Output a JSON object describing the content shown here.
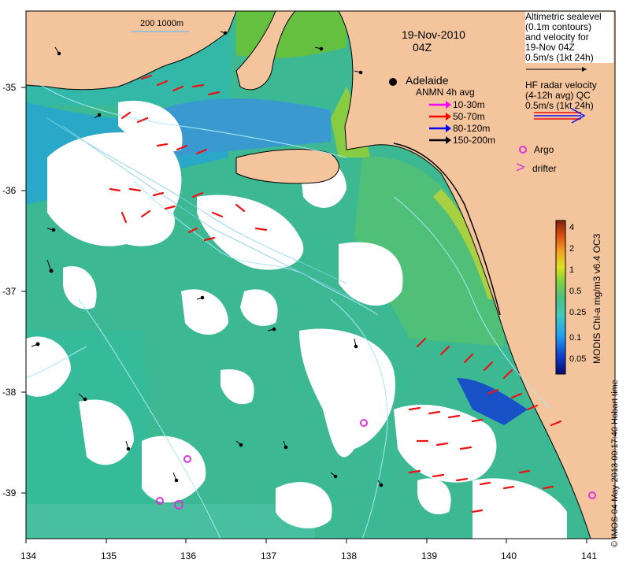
{
  "map": {
    "date": "19-Nov-2010",
    "time": "04Z",
    "scale_label": "200  1000m",
    "city": "Adelaide",
    "credit": "© IMOS 04-May-2013 00:17:40 Hobart time",
    "x_ticks": [
      "134",
      "135",
      "136",
      "137",
      "138",
      "139",
      "140",
      "141"
    ],
    "y_ticks": [
      "-35",
      "-36",
      "-37",
      "-38",
      "-39"
    ]
  },
  "legend": {
    "altimetric": [
      "Altimetric sealevel",
      "(0.1m contours)",
      "and velocity for",
      "19-Nov 04Z",
      "0.5m/s (1kt 24h)"
    ],
    "hf_radar": [
      "HF radar velocity",
      "(4-12h avg) QC",
      "0.5m/s (1kt 24h)"
    ],
    "anmn_title": "ANMN 4h avg",
    "anmn_items": [
      {
        "label": "10-30m",
        "color": "#ff00ff"
      },
      {
        "label": "50-70m",
        "color": "#ff0000"
      },
      {
        "label": "80-120m",
        "color": "#0000ff"
      },
      {
        "label": "150-200m",
        "color": "#000000"
      }
    ],
    "argo": "Argo",
    "drifter": "drifter",
    "drifter_symbol": ">"
  },
  "colorbar": {
    "title": "MODIS Chl-a mg/m3 v6.4 OC3",
    "ticks": [
      "4",
      "2",
      "1",
      "0.5",
      "0.25",
      "0.1",
      "0.05"
    ]
  },
  "colors": {
    "land": "#f4c49c",
    "ocean_green": "#40b890",
    "cloud": "#ffffff",
    "hf_radar": "#ee1111",
    "argo": "#dd33dd",
    "bathymetry": "#a8e8f8"
  }
}
